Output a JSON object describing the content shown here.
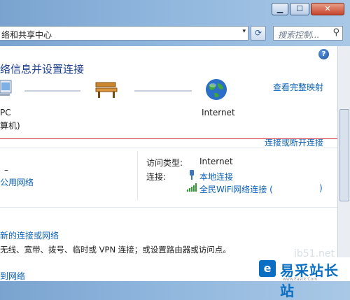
{
  "titlebar": {
    "minimize": "▁",
    "maximize": "☐",
    "close": "✕"
  },
  "address": {
    "path": "络和共享中心",
    "dropdown": "▾"
  },
  "search": {
    "placeholder": "搜索控制...",
    "icon": "search-icon"
  },
  "refresh_icon": "⟳",
  "help": "?",
  "heading": "络信息并设置连接",
  "map": {
    "full_map_link": "查看完整映射",
    "pc_label_1": "PC",
    "pc_label_2": "算机)",
    "internet_label": "Internet",
    "connect_link": "连接或断开连接"
  },
  "network": {
    "name": "–",
    "type_link": "公用网络",
    "access_type_label": "访问类型:",
    "access_type_value": "Internet",
    "connections_label": "连接:",
    "conn1": "本地连接",
    "conn2": "全民WiFi网络连接 (",
    "conn2_end": ")"
  },
  "tasks": {
    "new_connection_link": "新的连接或网络",
    "new_connection_desc": "无线、宽带、拨号、临时或 VPN 连接；或设置路由器或访问点。",
    "bottom_link": "到网络"
  },
  "watermark": {
    "logo_letter": "e",
    "brand": "易采站长站",
    "small": "www.Easck.Com",
    "faint": "jb51.net"
  }
}
